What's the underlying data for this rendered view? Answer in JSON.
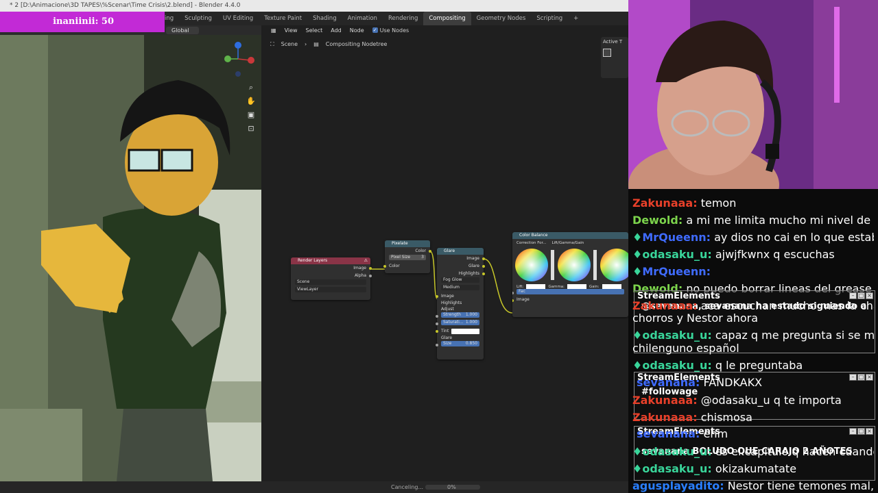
{
  "window": {
    "title": "* 2 [D:\\Animacione\\3D TAPES\\%Scenar\\Time Crisis\\2.blend] - Blender 4.4.0",
    "overlay_counter": "inaniinii: 50"
  },
  "workspace_tabs": [
    "ing",
    "Sculpting",
    "UV Editing",
    "Texture Paint",
    "Shading",
    "Animation",
    "Rendering",
    "Compositing",
    "Geometry Nodes",
    "Scripting",
    "+"
  ],
  "active_tab": "Compositing",
  "viewport": {
    "orientation": "Global"
  },
  "node_editor": {
    "menu": [
      "View",
      "Select",
      "Add",
      "Node"
    ],
    "use_nodes_label": "Use Nodes",
    "breadcrumb": [
      "Scene",
      "Compositing Nodetree"
    ],
    "active_tool_label": "Active T",
    "nodes": {
      "render_layers": {
        "title": "Render Layers",
        "outputs": [
          "Image",
          "Alpha"
        ],
        "scene": "Scene",
        "view_layer": "ViewLayer"
      },
      "pixelate": {
        "title": "Pixelate",
        "output": "Color",
        "pixel_size_label": "Pixel Size",
        "pixel_size_value": "3",
        "input": "Color"
      },
      "glare": {
        "title": "Glare",
        "outputs": [
          "Image",
          "Glare",
          "Highlights"
        ],
        "type": "Fog Glow",
        "quality": "Medium",
        "input": "Image",
        "sections": [
          "Highlights",
          "Adjust"
        ],
        "strength_label": "Strength",
        "strength_value": "1.000",
        "saturation_label": "Saturati...",
        "saturation_value": "1.000",
        "tint_label": "Tint",
        "glare_section": "Glare",
        "size_label": "Size",
        "size_value": "0.850"
      },
      "color_balance": {
        "title": "Color Balance",
        "correction_label": "Correction For...",
        "mode": "Lift/Gamma/Gain",
        "lift": "Lift:",
        "gamma": "Gamma:",
        "gain": "Gain:",
        "fac": "Fac",
        "input": "Image"
      }
    }
  },
  "status": {
    "text": "Canceling...",
    "percent": "0%"
  },
  "chat": {
    "messages": [
      {
        "user": "Zakunaaa:",
        "text": "temon",
        "color": "#e8402a"
      },
      {
        "user": "Dewold:",
        "text": "a mi me limita mucho mi nivel de ingles",
        "color": "#7cd44c"
      },
      {
        "user": "MrQueenn:",
        "text": "ay dios no cai en lo que estabas escuchando",
        "color": "#3f6bff"
      },
      {
        "user": "odasaku_u:",
        "text": "ajwjfkwnx q escuchas",
        "color": "#39d59a"
      },
      {
        "user": "MrQueenn:",
        "text": "",
        "color": "#3f6bff"
      },
      {
        "user": "Dewold:",
        "text": "no puedo borrar lineas del grease pencil y me esta filteando",
        "color": "#7cd44c"
      },
      {
        "user": "Zakunaaa:",
        "text": "aca escuchan mucho mas la champions liga, pero yo era mas de pibes",
        "color": "#e8402a"
      },
      {
        "user": "",
        "text": "chorros y Nestor ahora",
        "color": "#ffffff"
      },
      {
        "user": "odasaku_u:",
        "text": "capaz q me pregunta si se mucho ingles y yo vengo a",
        "color": "#39d59a"
      },
      {
        "user": "",
        "text": "chilenguno español",
        "color": "#ffffff"
      },
      {
        "user": "odasaku_u:",
        "text": "q le preguntaba",
        "color": "#39d59a"
      },
      {
        "user": "sevanana:",
        "text": "FANDKAKX",
        "color": "#3f6bff"
      },
      {
        "user": "Zakunaaa:",
        "text": "@odasaku_u q te importa",
        "color": "#e8402a"
      },
      {
        "user": "Zakunaaa:",
        "text": "chismosa",
        "color": "#e8402a"
      },
      {
        "user": "sevanana:",
        "text": "ehm",
        "color": "#3f6bff"
      },
      {
        "user": "odasaku_u:",
        "text": "es el capitulo q hacen cuando se quedan sin ideas",
        "color": "#39d59a"
      },
      {
        "user": "odasaku_u:",
        "text": "okizakumatate",
        "color": "#39d59a"
      },
      {
        "user": "agusplayadito:",
        "text": "Nestor tiene temones mal, covers de Camilo Sesto q estan buenos",
        "color": "#2a7fff"
      }
    ],
    "streamelements": [
      {
        "title": "StreamElements",
        "message": "@sevanana, sevanana ha estado siguiendo a"
      },
      {
        "title": "StreamElements",
        "message": "#followage"
      },
      {
        "title": "StreamElements",
        "message": "sevanana BOLUDO QUE CARAJO 2 AÑOTES"
      }
    ]
  }
}
